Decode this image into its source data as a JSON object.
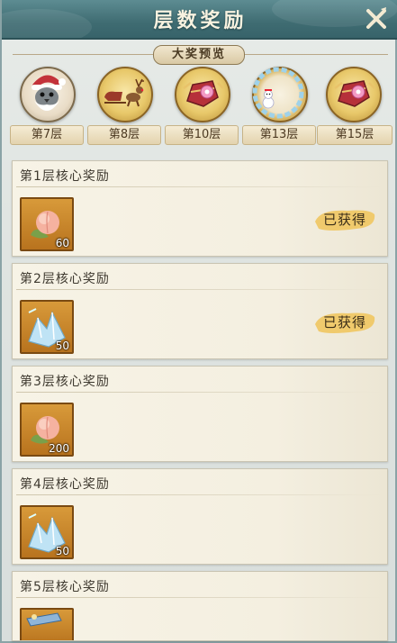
{
  "header": {
    "title": "层数奖励"
  },
  "preview": {
    "banner": "大奖预览",
    "prizes": [
      {
        "icon": "pigeon-santa-avatar-icon",
        "label": "第7层"
      },
      {
        "icon": "reindeer-sleigh-icon",
        "label": "第8层"
      },
      {
        "icon": "ornate-box-icon",
        "label": "第10层"
      },
      {
        "icon": "snowman-frame-icon",
        "label": "第13层"
      },
      {
        "icon": "ornate-box-icon",
        "label": "第15层"
      }
    ]
  },
  "rewards": [
    {
      "title": "第1层核心奖励",
      "item_icon": "peach-icon",
      "count": "60",
      "status": "已获得"
    },
    {
      "title": "第2层核心奖励",
      "item_icon": "ice-crystal-icon",
      "count": "50",
      "status": "已获得"
    },
    {
      "title": "第3层核心奖励",
      "item_icon": "peach-icon",
      "count": "200",
      "status": ""
    },
    {
      "title": "第4层核心奖励",
      "item_icon": "ice-crystal-icon",
      "count": "50",
      "status": ""
    },
    {
      "title": "第5层核心奖励",
      "item_icon": "scroll-icon",
      "count": "",
      "status": ""
    }
  ],
  "colors": {
    "header": "#3f6c72",
    "card": "#f5f0e2",
    "item_bg": "#c88328",
    "claimed_stamp": "#f0c760"
  }
}
